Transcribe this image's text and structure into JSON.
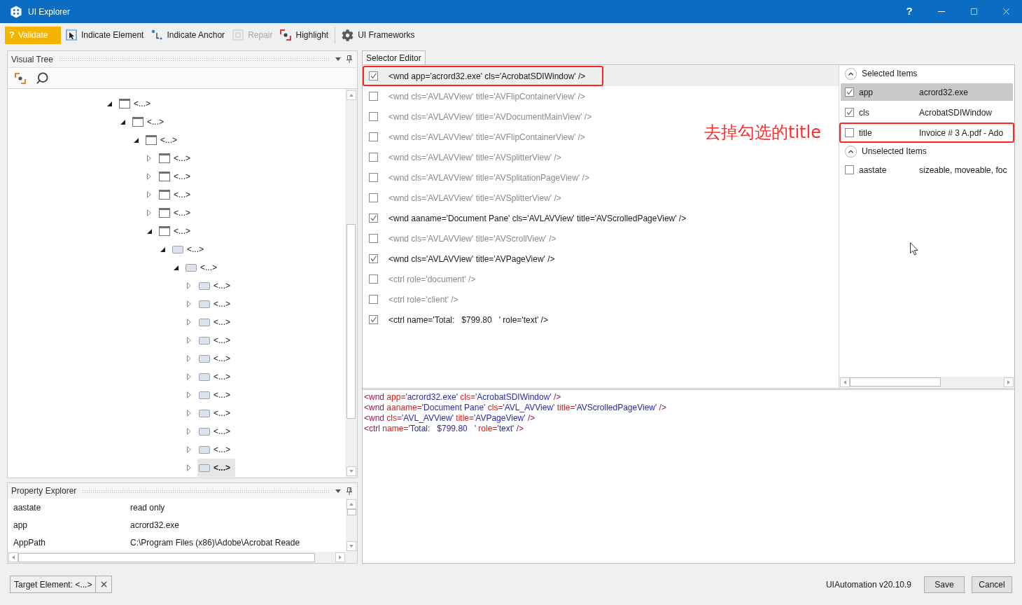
{
  "window": {
    "title": "UI Explorer",
    "help": "?"
  },
  "toolbar": [
    {
      "kind": "validate",
      "glyph": "?",
      "label": "Validate",
      "disabled": false
    },
    {
      "kind": "indicate_element",
      "label": "Indicate Element",
      "disabled": false
    },
    {
      "kind": "indicate_anchor",
      "label": "Indicate Anchor",
      "disabled": false
    },
    {
      "kind": "repair",
      "label": "Repair",
      "disabled": true
    },
    {
      "kind": "highlight",
      "label": "Highlight",
      "disabled": false
    },
    {
      "kind": "frameworks",
      "label": "UI Frameworks",
      "disabled": false
    }
  ],
  "visual_tree": {
    "title": "Visual Tree",
    "nodes": [
      {
        "label": "<...>",
        "kind": "window",
        "expanded": true,
        "selected": false,
        "children": [
          {
            "label": "<...>",
            "kind": "window",
            "expanded": true,
            "selected": false,
            "children": [
              {
                "label": "<...>",
                "kind": "window",
                "expanded": true,
                "selected": false,
                "children": [
                  {
                    "label": "<...>",
                    "kind": "window",
                    "expanded": false,
                    "selected": false
                  },
                  {
                    "label": "<...>",
                    "kind": "window",
                    "expanded": false,
                    "selected": false
                  },
                  {
                    "label": "<...>",
                    "kind": "window",
                    "expanded": false,
                    "selected": false
                  },
                  {
                    "label": "<...>",
                    "kind": "window",
                    "expanded": false,
                    "selected": false
                  },
                  {
                    "label": "<...>",
                    "kind": "window",
                    "expanded": true,
                    "selected": false,
                    "children": [
                      {
                        "label": "<...>",
                        "kind": "pane",
                        "expanded": true,
                        "selected": false,
                        "children": [
                          {
                            "label": "<...>",
                            "kind": "pane",
                            "expanded": true,
                            "selected": false,
                            "children": [
                              {
                                "label": "<...>",
                                "kind": "pane",
                                "expanded": false,
                                "selected": false
                              },
                              {
                                "label": "<...>",
                                "kind": "pane",
                                "expanded": false,
                                "selected": false
                              },
                              {
                                "label": "<...>",
                                "kind": "pane",
                                "expanded": false,
                                "selected": false
                              },
                              {
                                "label": "<...>",
                                "kind": "pane",
                                "expanded": false,
                                "selected": false
                              },
                              {
                                "label": "<...>",
                                "kind": "pane",
                                "expanded": false,
                                "selected": false
                              },
                              {
                                "label": "<...>",
                                "kind": "pane",
                                "expanded": false,
                                "selected": false
                              },
                              {
                                "label": "<...>",
                                "kind": "pane",
                                "expanded": false,
                                "selected": false
                              },
                              {
                                "label": "<...>",
                                "kind": "pane",
                                "expanded": false,
                                "selected": false
                              },
                              {
                                "label": "<...>",
                                "kind": "pane",
                                "expanded": false,
                                "selected": false
                              },
                              {
                                "label": "<...>",
                                "kind": "pane",
                                "expanded": false,
                                "selected": false
                              },
                              {
                                "label": "<...>",
                                "kind": "pane",
                                "expanded": false,
                                "selected": true
                              }
                            ]
                          }
                        ]
                      }
                    ]
                  }
                ]
              }
            ]
          }
        ]
      }
    ]
  },
  "property_explorer": {
    "title": "Property Explorer",
    "rows": [
      {
        "name": "aastate",
        "value": "read only"
      },
      {
        "name": "app",
        "value": "acrord32.exe"
      },
      {
        "name": "AppPath",
        "value": "C:\\Program Files (x86)\\Adobe\\Acrobat Reade"
      }
    ]
  },
  "target_element": {
    "label": "Target Element: <...>"
  },
  "selector_editor": {
    "tab": "Selector Editor",
    "rows": [
      {
        "text": "<wnd app='acrord32.exe' cls='AcrobatSDIWindow' />",
        "checked": true,
        "selected": true,
        "marked": true
      },
      {
        "text": "<wnd cls='AVLAVView' title='AVFlipContainerView' />",
        "checked": false,
        "selected": false,
        "marked": false
      },
      {
        "text": "<wnd cls='AVLAVView' title='AVDocumentMainView' />",
        "checked": false,
        "selected": false,
        "marked": false
      },
      {
        "text": "<wnd cls='AVLAVView' title='AVFlipContainerView' />",
        "checked": false,
        "selected": false,
        "marked": false
      },
      {
        "text": "<wnd cls='AVLAVView' title='AVSplitterView' />",
        "checked": false,
        "selected": false,
        "marked": false
      },
      {
        "text": "<wnd cls='AVLAVView' title='AVSplitationPageView' />",
        "checked": false,
        "selected": false,
        "marked": false
      },
      {
        "text": "<wnd cls='AVLAVView' title='AVSplitterView' />",
        "checked": false,
        "selected": false,
        "marked": false
      },
      {
        "text": "<wnd aaname='Document Pane' cls='AVLAVView' title='AVScrolledPageView' />",
        "checked": true,
        "selected": false,
        "marked": false
      },
      {
        "text": "<wnd cls='AVLAVView' title='AVScrollView' />",
        "checked": false,
        "selected": false,
        "marked": false
      },
      {
        "text": "<wnd cls='AVLAVView' title='AVPageView' />",
        "checked": true,
        "selected": false,
        "marked": false
      },
      {
        "text": "<ctrl role='document' />",
        "checked": false,
        "selected": false,
        "marked": false
      },
      {
        "text": "<ctrl role='client' />",
        "checked": false,
        "selected": false,
        "marked": false
      },
      {
        "text": "<ctrl name='Total:   $799.80   ' role='text' />",
        "checked": true,
        "selected": false,
        "marked": false
      }
    ]
  },
  "annotation": {
    "note": "去掉勾选的title"
  },
  "attributes": {
    "groups": [
      {
        "title": "Selected Items",
        "expanded": true,
        "items": [
          {
            "name": "app",
            "value": "acrord32.exe",
            "checked": true,
            "selected": true,
            "marked": false
          },
          {
            "name": "cls",
            "value": "AcrobatSDIWindow",
            "checked": true,
            "selected": false,
            "marked": false
          },
          {
            "name": "title",
            "value": "Invoice # 3 A.pdf - Ado",
            "checked": false,
            "selected": false,
            "marked": true
          }
        ]
      },
      {
        "title": "Unselected Items",
        "expanded": true,
        "items": [
          {
            "name": "aastate",
            "value": "sizeable, moveable, foc",
            "checked": false,
            "selected": false,
            "marked": false
          }
        ]
      }
    ]
  },
  "preview": {
    "lines": [
      {
        "tokens": [
          {
            "kind": "tag",
            "text": "<wnd"
          },
          {
            "kind": "attr",
            "text": " app="
          },
          {
            "kind": "value",
            "text": "'acrord32.exe'"
          },
          {
            "kind": "attr",
            "text": " cls="
          },
          {
            "kind": "value",
            "text": "'AcrobatSDIWindow'"
          },
          {
            "kind": "tag",
            "text": " />"
          }
        ]
      },
      {
        "tokens": [
          {
            "kind": "tag",
            "text": "<wnd"
          },
          {
            "kind": "attr",
            "text": " aaname="
          },
          {
            "kind": "value",
            "text": "'Document Pane'"
          },
          {
            "kind": "attr",
            "text": " cls="
          },
          {
            "kind": "value",
            "text": "'AVL_AVView'"
          },
          {
            "kind": "attr",
            "text": " title="
          },
          {
            "kind": "value",
            "text": "'AVScrolledPageView'"
          },
          {
            "kind": "tag",
            "text": " />"
          }
        ]
      },
      {
        "tokens": [
          {
            "kind": "tag",
            "text": "<wnd"
          },
          {
            "kind": "attr",
            "text": " cls="
          },
          {
            "kind": "value",
            "text": "'AVL_AVView'"
          },
          {
            "kind": "attr",
            "text": " title="
          },
          {
            "kind": "value",
            "text": "'AVPageView'"
          },
          {
            "kind": "tag",
            "text": " />"
          }
        ]
      },
      {
        "tokens": [
          {
            "kind": "tag",
            "text": "<ctrl"
          },
          {
            "kind": "attr",
            "text": " name="
          },
          {
            "kind": "value",
            "text": "'Total:   $799.80   '"
          },
          {
            "kind": "attr",
            "text": " role="
          },
          {
            "kind": "value",
            "text": "'text'"
          },
          {
            "kind": "tag",
            "text": " />"
          }
        ]
      }
    ]
  },
  "footer": {
    "status": "UIAutomation v20.10.9",
    "buttons": [
      "Save",
      "Cancel"
    ]
  }
}
